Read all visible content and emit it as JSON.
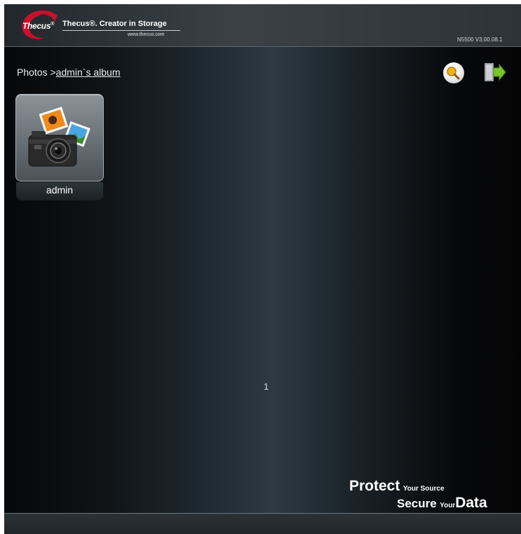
{
  "header": {
    "logo_text": "Thecus",
    "logo_sup": "®",
    "tagline": "Thecus®. Creator in Storage",
    "website": "www.thecus.com",
    "version": "N5500 V3.00.08.1"
  },
  "breadcrumb": {
    "root": "Photos",
    "separator": " >",
    "current": "admin`s album"
  },
  "toolbar": {
    "search_icon": "magnifier-icon",
    "logout_icon": "logout-arrow-icon"
  },
  "albums": [
    {
      "label": "admin",
      "icon": "camera-photos-icon"
    }
  ],
  "pagination": {
    "current_page": "1"
  },
  "slogan": {
    "protect": "Protect",
    "your_source": "Your Source",
    "secure": "Secure",
    "your": "Your",
    "data": "Data"
  },
  "colors": {
    "accent_red": "#c8102e",
    "background": "#0a0b0c",
    "text": "#ffffff"
  }
}
